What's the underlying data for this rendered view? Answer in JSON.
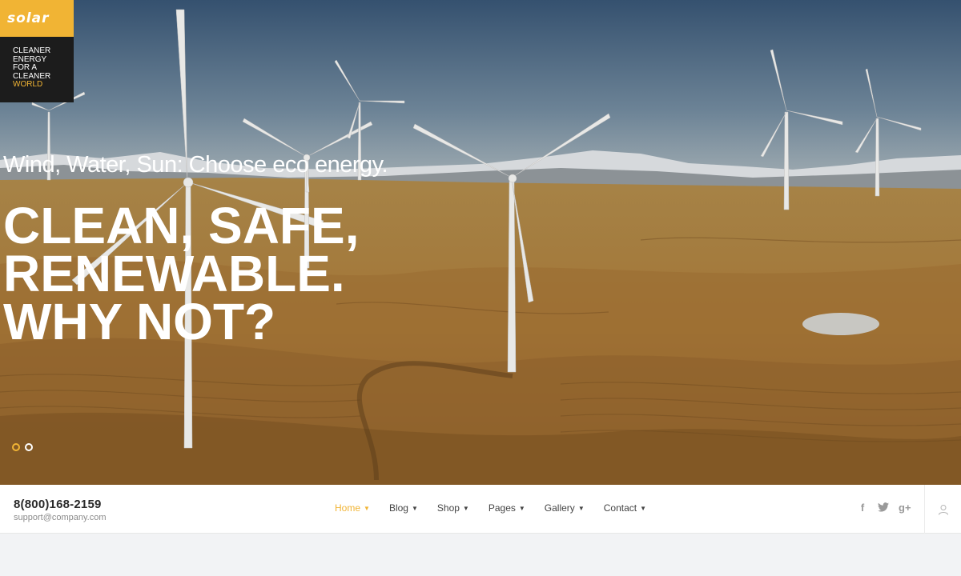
{
  "brand": {
    "logo_text": "solar",
    "tagline_lines": [
      "CLEANER",
      "ENERGY",
      "FOR A",
      "CLEANER"
    ],
    "tagline_highlight": "WORLD",
    "accent_color": "#f1b434"
  },
  "hero": {
    "subtitle": "Wind, Water, Sun: Choose eco energy.",
    "title_lines": [
      "CLEAN, SAFE,",
      "RENEWABLE.",
      "WHY NOT?"
    ],
    "slides_total": 2,
    "slide_active": 1
  },
  "contact": {
    "phone": "8(800)168-2159",
    "email": "support@company.com"
  },
  "menu": {
    "items": [
      {
        "label": "Home",
        "active": true
      },
      {
        "label": "Blog",
        "active": false
      },
      {
        "label": "Shop",
        "active": false
      },
      {
        "label": "Pages",
        "active": false
      },
      {
        "label": "Gallery",
        "active": false
      },
      {
        "label": "Contact",
        "active": false
      }
    ],
    "chevron": "chevron-down-icon"
  },
  "social": {
    "icons": [
      "facebook-icon",
      "twitter-icon",
      "google-plus-icon"
    ],
    "facebook_glyph": "f",
    "google_glyph": "g+"
  },
  "user": {
    "icon": "user-icon"
  }
}
